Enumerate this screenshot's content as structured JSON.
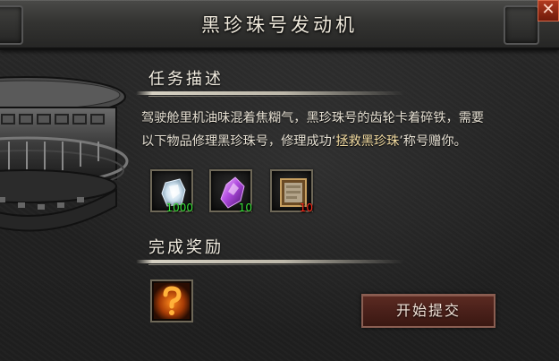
{
  "dialog": {
    "title": "黑珍珠号发动机",
    "close_symbol": "✕"
  },
  "task": {
    "header": "任务描述",
    "line1": "驾驶舱里机油味混着焦糊气，黑珍珠号的齿轮卡着碎铁，需要",
    "line2_before": "以下物品修理黑珍珠号，修理成功‘",
    "line2_highlight": "拯救黑珍珠",
    "line2_after": "’称号赠你。"
  },
  "materials": [
    {
      "icon": "crystal-icon",
      "qty": "1000",
      "status": "sufficient",
      "color": "#39e23a"
    },
    {
      "icon": "purple-gem-icon",
      "qty": "10",
      "status": "sufficient",
      "color": "#39e23a"
    },
    {
      "icon": "scroll-icon",
      "qty": "10",
      "status": "insufficient",
      "color": "#ff2a1a"
    }
  ],
  "reward": {
    "header": "完成奖励",
    "icon": "mystery-question-icon"
  },
  "actions": {
    "submit_label": "开始提交"
  },
  "colors": {
    "sufficient": "#39e23a",
    "insufficient": "#ff2a1a",
    "highlight": "#f0d9a0",
    "button": "#4a201a"
  }
}
